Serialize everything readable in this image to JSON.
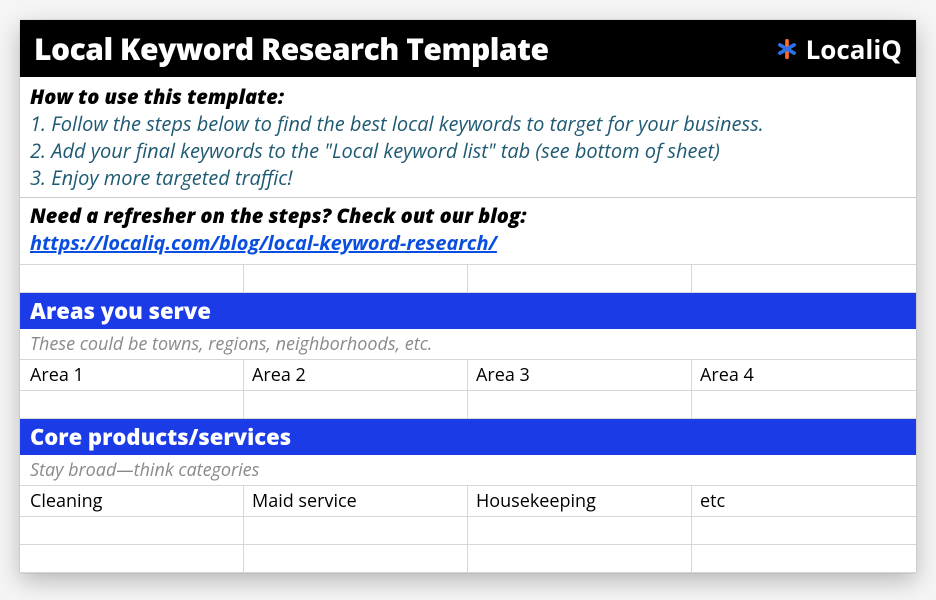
{
  "title": "Local Keyword Research Template",
  "brand": {
    "name": "LocaliQ"
  },
  "instructions": {
    "lead": "How to use this template:",
    "steps": [
      "1. Follow the steps below to find the best local keywords to target for your business.",
      "2. Add your final keywords to the \"Local keyword list\" tab (see bottom of sheet)",
      "3. Enjoy more targeted traffic!"
    ]
  },
  "refresher": {
    "lead": "Need a refresher on the steps? Check out our blog:",
    "link_text": "https://localiq.com/blog/local-keyword-research/",
    "link_href": "https://localiq.com/blog/local-keyword-research/"
  },
  "sections": {
    "areas": {
      "header": "Areas you serve",
      "note": "These could be towns, regions, neighborhoods, etc.",
      "row1": [
        "Area 1",
        "Area 2",
        "Area 3",
        "Area 4"
      ],
      "row2": [
        "",
        "",
        "",
        ""
      ]
    },
    "products": {
      "header": "Core products/services",
      "note": "Stay broad—think categories",
      "row1": [
        "Cleaning",
        "Maid service",
        "Housekeeping",
        "etc"
      ],
      "row2": [
        "",
        "",
        "",
        ""
      ],
      "row3": [
        "",
        "",
        "",
        ""
      ]
    }
  },
  "chart_data": {
    "type": "table",
    "title": "Local Keyword Research Template",
    "tables": [
      {
        "name": "Areas you serve",
        "note": "These could be towns, regions, neighborhoods, etc.",
        "rows": [
          [
            "Area 1",
            "Area 2",
            "Area 3",
            "Area 4"
          ]
        ]
      },
      {
        "name": "Core products/services",
        "note": "Stay broad—think categories",
        "rows": [
          [
            "Cleaning",
            "Maid service",
            "Housekeeping",
            "etc"
          ]
        ]
      }
    ]
  }
}
